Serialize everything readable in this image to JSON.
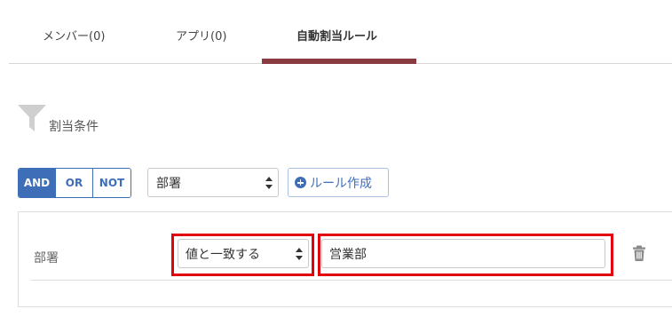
{
  "tabs": [
    {
      "label": "メンバー(0)"
    },
    {
      "label": "アプリ(0)"
    },
    {
      "label": "自動割当ルール"
    }
  ],
  "section": {
    "title": "割当条件",
    "icon": "filter-icon"
  },
  "logic": {
    "options": [
      "AND",
      "OR",
      "NOT"
    ],
    "selected": "AND"
  },
  "field_select": {
    "value": "部署"
  },
  "add_rule_button": {
    "label": "ルール作成",
    "icon": "plus-circle-icon"
  },
  "rule": {
    "field_label": "部署",
    "operator": "値と一致する",
    "value": "営業部",
    "delete_icon": "trash-icon"
  },
  "colors": {
    "accent": "#3e6eb8",
    "tab_indicator": "#8a3b42",
    "highlight": "#e3000f"
  }
}
